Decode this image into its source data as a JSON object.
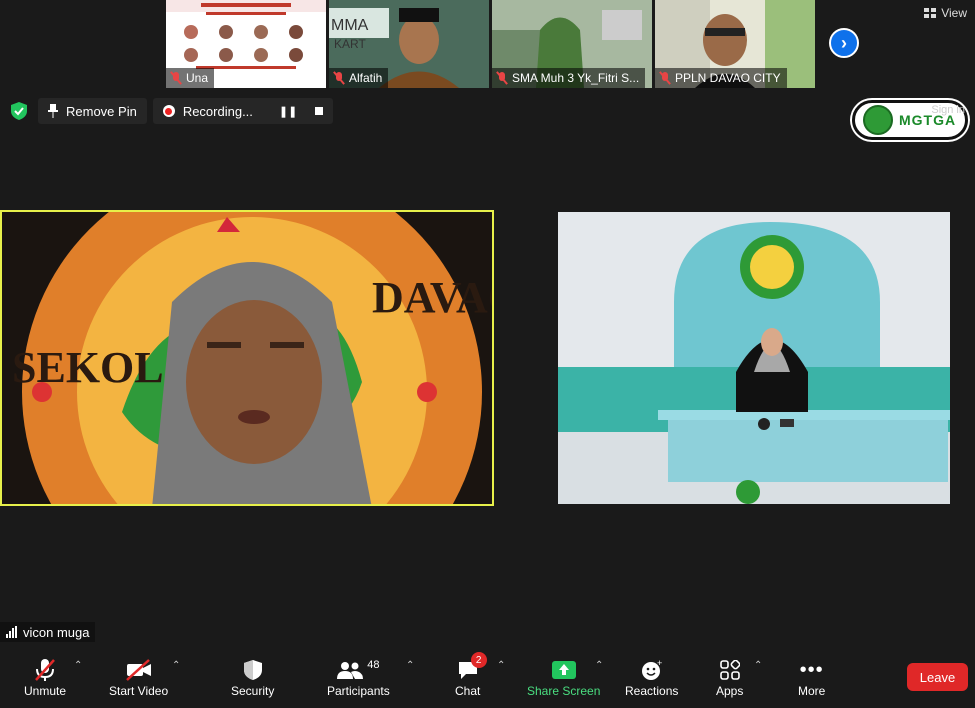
{
  "participants_strip": [
    {
      "name": "Una"
    },
    {
      "name": "Alfatih"
    },
    {
      "name": "SMA Muh 3 Yk_Fitri S..."
    },
    {
      "name": "PPLN DAVAO CITY"
    }
  ],
  "view_label": "View",
  "pin_label": "Remove Pin",
  "recording_label": "Recording...",
  "sign_in_label": "Sign in",
  "logo_text": "MGTGA",
  "active_speaker": "vicon muga",
  "toolbar": {
    "unmute": "Unmute",
    "start_video": "Start Video",
    "security": "Security",
    "participants": "Participants",
    "participants_count": "48",
    "chat": "Chat",
    "chat_badge": "2",
    "share_screen": "Share Screen",
    "reactions": "Reactions",
    "apps": "Apps",
    "more": "More",
    "leave": "Leave"
  },
  "colors": {
    "share_green": "#22c55e",
    "leave_red": "#e02828",
    "accent_blue": "#0e71eb"
  }
}
